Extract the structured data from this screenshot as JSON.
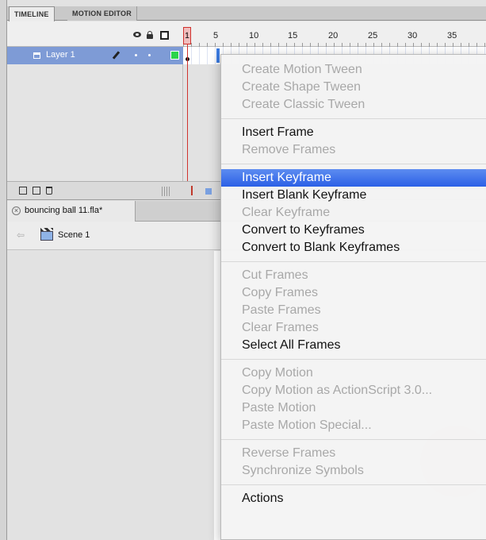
{
  "tabs": {
    "timeline": "TIMELINE",
    "motion_editor": "MOTION EDITOR"
  },
  "ruler": {
    "numbers": [
      "1",
      "5",
      "10",
      "15",
      "20",
      "25",
      "30",
      "35"
    ]
  },
  "layer": {
    "name": "Layer 1",
    "color": "#2bd44b"
  },
  "document": {
    "title": "bouncing ball 11.fla*",
    "scene": "Scene 1"
  },
  "menu": {
    "create_motion_tween": "Create Motion Tween",
    "create_shape_tween": "Create Shape Tween",
    "create_classic_tween": "Create Classic Tween",
    "insert_frame": "Insert Frame",
    "remove_frames": "Remove Frames",
    "insert_keyframe": "Insert Keyframe",
    "insert_blank_keyframe": "Insert Blank Keyframe",
    "clear_keyframe": "Clear Keyframe",
    "convert_to_keyframes": "Convert to Keyframes",
    "convert_to_blank_keyframes": "Convert to Blank Keyframes",
    "cut_frames": "Cut Frames",
    "copy_frames": "Copy Frames",
    "paste_frames": "Paste Frames",
    "clear_frames": "Clear Frames",
    "select_all_frames": "Select All Frames",
    "copy_motion": "Copy Motion",
    "copy_motion_as3": "Copy Motion as ActionScript 3.0...",
    "paste_motion": "Paste Motion",
    "paste_motion_special": "Paste Motion Special...",
    "reverse_frames": "Reverse Frames",
    "synchronize_symbols": "Synchronize Symbols",
    "actions": "Actions"
  },
  "colors": {
    "highlight": "#2b60e6",
    "playhead": "#d0312d",
    "layer_selected": "#7e9bd6"
  }
}
